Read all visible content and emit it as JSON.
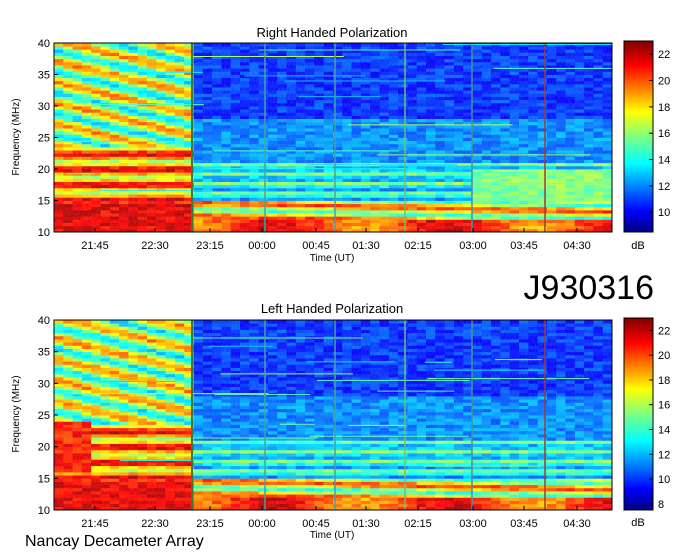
{
  "event_id": "J930316",
  "instrument": "Nancay Decameter Array",
  "chart_data": [
    {
      "type": "heatmap",
      "title": "Right Handed Polarization",
      "xlabel": "Time (UT)",
      "ylabel": "Frequency (MHz)",
      "x_ticks": [
        "21:45",
        "22:30",
        "23:15",
        "00:00",
        "00:45",
        "01:30",
        "02:15",
        "03:00",
        "03:45",
        "04:30"
      ],
      "y_ticks": [
        10,
        15,
        20,
        25,
        30,
        35,
        40
      ],
      "ylim": [
        10,
        40
      ],
      "colorbar": {
        "label": "dB",
        "ticks": [
          10,
          12,
          14,
          16,
          18,
          20,
          22
        ],
        "range": [
          8.5,
          23
        ]
      },
      "colormap": "jet"
    },
    {
      "type": "heatmap",
      "title": "Left Handed Polarization",
      "xlabel": "Time (UT)",
      "ylabel": "Frequency (MHz)",
      "x_ticks": [
        "21:45",
        "22:30",
        "23:15",
        "00:00",
        "00:45",
        "01:30",
        "02:15",
        "03:00",
        "03:45",
        "04:30"
      ],
      "y_ticks": [
        10,
        15,
        20,
        25,
        30,
        35,
        40
      ],
      "ylim": [
        10,
        40
      ],
      "colorbar": {
        "label": "dB",
        "ticks": [
          8,
          10,
          12,
          14,
          16,
          18,
          20,
          22
        ],
        "range": [
          7.5,
          23
        ]
      },
      "colormap": "jet"
    }
  ]
}
